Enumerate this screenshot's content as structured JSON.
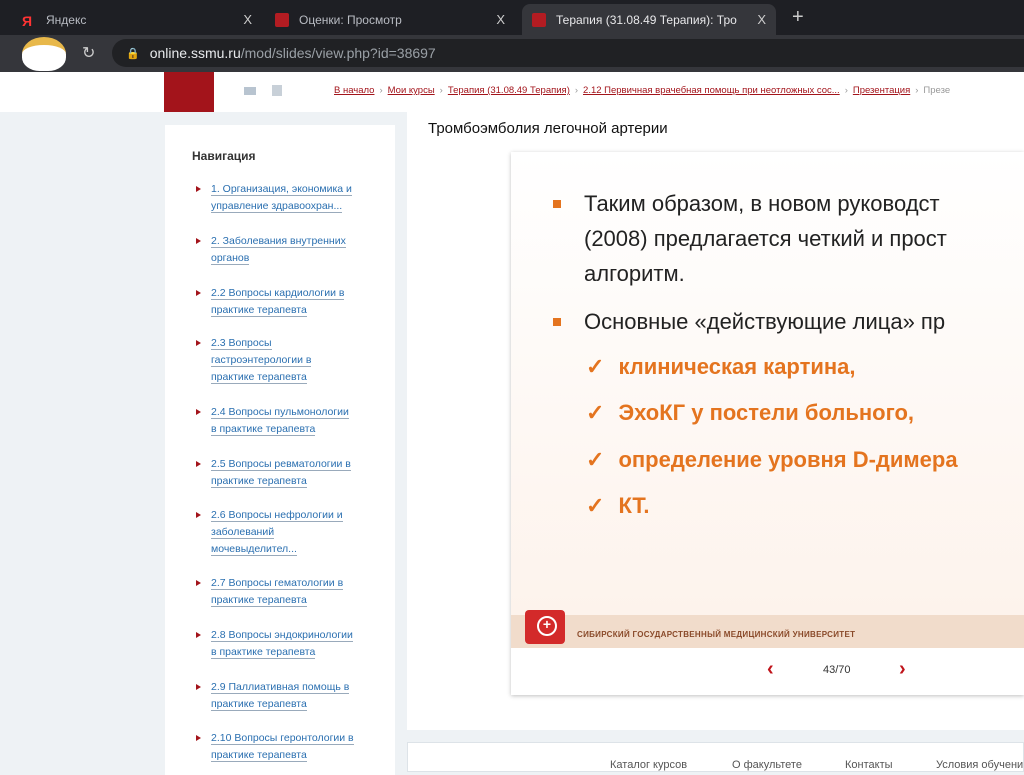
{
  "browser": {
    "tabs": [
      {
        "label": "Яндекс",
        "icon": "yandex-icon"
      },
      {
        "label": "Оценки: Просмотр",
        "icon": "ssmu-icon"
      },
      {
        "label": "Терапия (31.08.49 Терапия): Тро",
        "icon": "ssmu-icon"
      }
    ],
    "url_host": "online.ssmu.ru",
    "url_path": "/mod/slides/view.php?id=38697",
    "close": "X",
    "new_tab": "+"
  },
  "breadcrumb": [
    "В начало",
    "Мои курсы",
    "Терапия (31.08.49 Терапия)",
    "2.12 Первичная врачебная помощь при неотложных сос...",
    "Презентация",
    "Презе"
  ],
  "sidebar": {
    "title": "Навигация",
    "items": [
      [
        "1. Организация, экономика и",
        "управление здравоохран..."
      ],
      [
        "2. Заболевания внутренних",
        "органов"
      ],
      [
        "2.2 Вопросы кардиологии в",
        "практике терапевта"
      ],
      [
        "2.3 Вопросы",
        "гастроэнтерологии в",
        "практике терапевта"
      ],
      [
        "2.4 Вопросы пульмонологии",
        "в практике терапевта"
      ],
      [
        "2.5 Вопросы ревматологии в",
        "практике терапевта"
      ],
      [
        "2.6 Вопросы нефрологии и",
        "заболеваний",
        "мочевыделител..."
      ],
      [
        "2.7 Вопросы гематологии в",
        "практике терапевта"
      ],
      [
        "2.8 Вопросы эндокринологии",
        "в практике терапевта"
      ],
      [
        "2.9 Паллиативная помощь в",
        "практике терапевта"
      ],
      [
        "2.10 Вопросы геронтологии в",
        "практике терапевта"
      ]
    ]
  },
  "main": {
    "title": "Тромбоэмболия легочной артерии"
  },
  "slide": {
    "lines": [
      "Таким образом, в новом руководст",
      "(2008) предлагается четкий и прост",
      "алгоритм.",
      "Основные «действующие лица» пр"
    ],
    "checks": [
      "клиническая картина,",
      "ЭхоКГ у постели больного,",
      "определение уровня D-димера",
      "КТ."
    ],
    "university": "СИБИРСКИЙ ГОСУДАРСТВЕННЫЙ МЕДИЦИНСКИЙ УНИВЕРСИТЕТ",
    "check_mark": "✓"
  },
  "pager": {
    "current": 43,
    "total": 70,
    "text": "43/70",
    "prev": "‹",
    "next": "›"
  },
  "footer": {
    "links": [
      "Каталог курсов",
      "О факультете",
      "Контакты",
      "Условия обучени"
    ]
  },
  "colors": {
    "accent": "#a3141b",
    "orange": "#e4741f"
  }
}
